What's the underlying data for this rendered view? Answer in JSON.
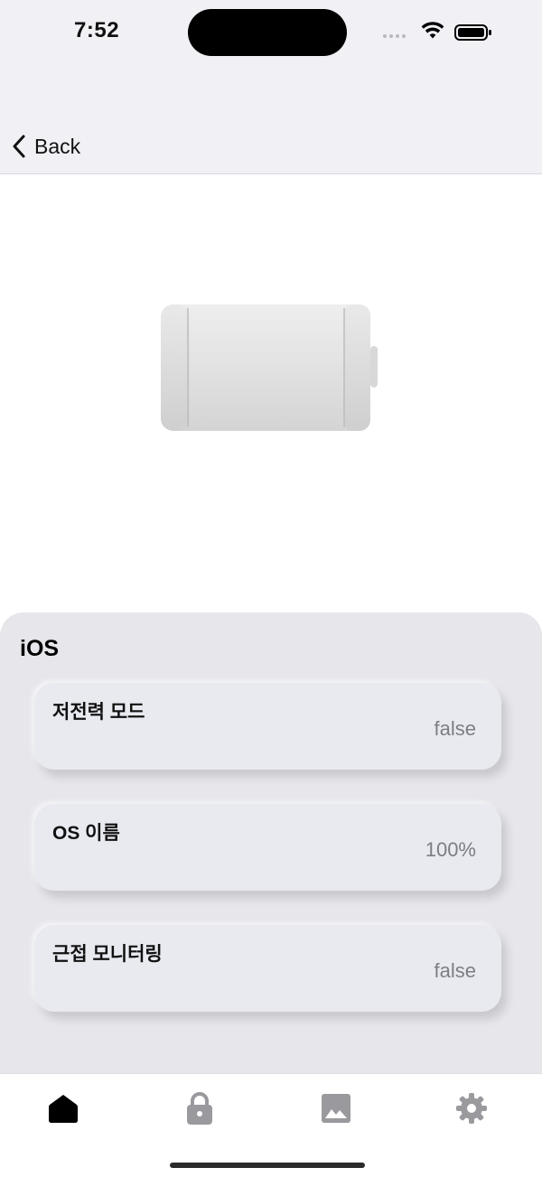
{
  "status_bar": {
    "time": "7:52",
    "icons": [
      "signal-dots-icon",
      "wifi-icon",
      "battery-icon"
    ]
  },
  "nav": {
    "back_label": "Back"
  },
  "hero": {
    "image": "battery-illustration"
  },
  "panel": {
    "title": "iOS",
    "items": [
      {
        "label": "저전력 모드",
        "value": "false"
      },
      {
        "label": "OS 이름",
        "value": "100%"
      },
      {
        "label": "근접 모니터링",
        "value": "false"
      }
    ]
  },
  "tab_bar": {
    "tabs": [
      {
        "icon": "home-icon",
        "active": true
      },
      {
        "icon": "lock-icon",
        "active": false
      },
      {
        "icon": "image-icon",
        "active": false
      },
      {
        "icon": "gear-icon",
        "active": false
      }
    ],
    "active_color": "#000000",
    "inactive_color": "#9a9a9e"
  }
}
